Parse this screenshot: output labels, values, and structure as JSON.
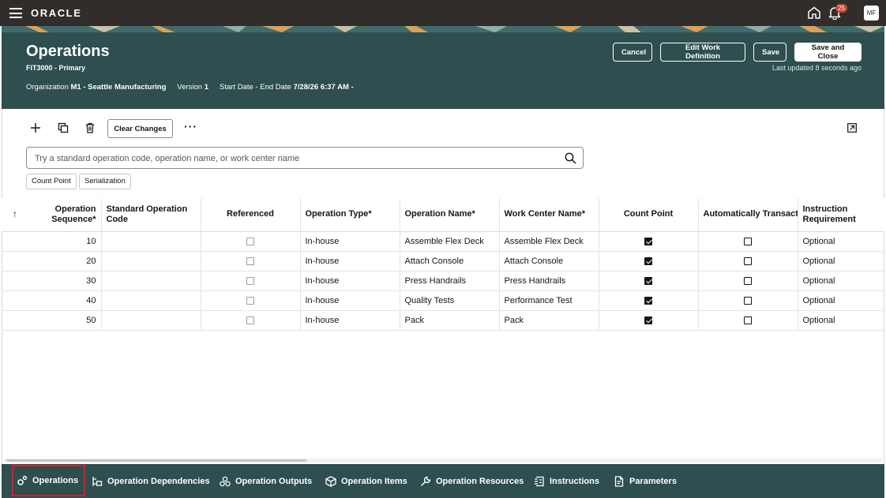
{
  "app": {
    "logo": "ORACLE",
    "notifications_count": "25",
    "user_initials": "MF"
  },
  "header": {
    "title": "Operations",
    "subtitle": "FIT3000 - Primary",
    "organization_label": "Organization",
    "organization_value": "M1 - Seattle Manufacturing",
    "version_label": "Version",
    "version_value": "1",
    "dates_label": "Start Date - End Date",
    "dates_value": "7/28/26 6:37 AM -",
    "buttons": {
      "cancel": "Cancel",
      "edit": "Edit Work Definition",
      "save": "Save",
      "save_close": "Save and Close"
    },
    "last_updated": "Last updated 8 seconds ago"
  },
  "toolbar": {
    "clear_changes": "Clear Changes",
    "more": "···"
  },
  "search": {
    "placeholder": "Try a standard operation code, operation name, or work center name",
    "value": ""
  },
  "filters": [
    "Count Point",
    "Serialization"
  ],
  "table": {
    "sort_indicator": "↑",
    "columns": [
      "Operation Sequence*",
      "Standard Operation Code",
      "Referenced",
      "Operation Type*",
      "Operation Name*",
      "Work Center Name*",
      "Count Point",
      "Automatically Transact",
      "Instruction Requirement"
    ],
    "rows": [
      {
        "seq": "10",
        "code": "",
        "referenced": false,
        "type": "In-house",
        "name": "Assemble Flex Deck",
        "work_center": "Assemble Flex Deck",
        "count_point": true,
        "auto_transact": false,
        "instruction": "Optional"
      },
      {
        "seq": "20",
        "code": "",
        "referenced": false,
        "type": "In-house",
        "name": "Attach Console",
        "work_center": "Attach Console",
        "count_point": true,
        "auto_transact": false,
        "instruction": "Optional"
      },
      {
        "seq": "30",
        "code": "",
        "referenced": false,
        "type": "In-house",
        "name": "Press Handrails",
        "work_center": "Press Handrails",
        "count_point": true,
        "auto_transact": false,
        "instruction": "Optional"
      },
      {
        "seq": "40",
        "code": "",
        "referenced": false,
        "type": "In-house",
        "name": "Quality Tests",
        "work_center": "Performance Test",
        "count_point": true,
        "auto_transact": false,
        "instruction": "Optional"
      },
      {
        "seq": "50",
        "code": "",
        "referenced": false,
        "type": "In-house",
        "name": "Pack",
        "work_center": "Pack",
        "count_point": true,
        "auto_transact": false,
        "instruction": "Optional"
      }
    ]
  },
  "bottom_tabs": [
    {
      "label": "Operations",
      "icon": "gears-icon",
      "active": true
    },
    {
      "label": "Operation Dependencies",
      "icon": "dependencies-icon",
      "active": false
    },
    {
      "label": "Operation Outputs",
      "icon": "outputs-icon",
      "active": false
    },
    {
      "label": "Operation Items",
      "icon": "box-icon",
      "active": false
    },
    {
      "label": "Operation Resources",
      "icon": "wrench-icon",
      "active": false
    },
    {
      "label": "Instructions",
      "icon": "instructions-icon",
      "active": false
    },
    {
      "label": "Parameters",
      "icon": "document-icon",
      "active": false
    }
  ],
  "colors": {
    "topbar": "#312d2a",
    "header": "#2e4e4f",
    "active_tab_outline": "#d4202a"
  }
}
